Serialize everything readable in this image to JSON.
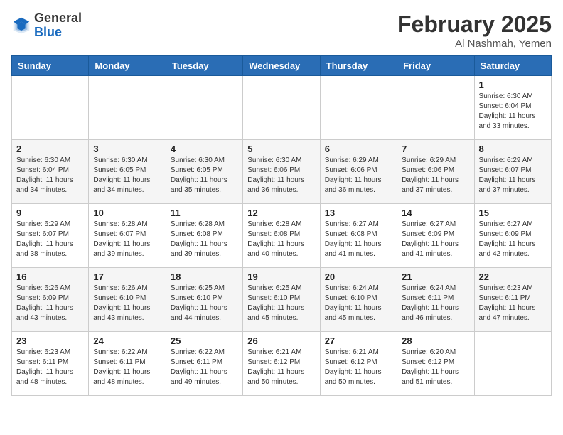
{
  "header": {
    "logo_general": "General",
    "logo_blue": "Blue",
    "month_title": "February 2025",
    "location": "Al Nashmah, Yemen"
  },
  "days_of_week": [
    "Sunday",
    "Monday",
    "Tuesday",
    "Wednesday",
    "Thursday",
    "Friday",
    "Saturday"
  ],
  "weeks": [
    [
      {
        "day": "",
        "info": ""
      },
      {
        "day": "",
        "info": ""
      },
      {
        "day": "",
        "info": ""
      },
      {
        "day": "",
        "info": ""
      },
      {
        "day": "",
        "info": ""
      },
      {
        "day": "",
        "info": ""
      },
      {
        "day": "1",
        "info": "Sunrise: 6:30 AM\nSunset: 6:04 PM\nDaylight: 11 hours\nand 33 minutes."
      }
    ],
    [
      {
        "day": "2",
        "info": "Sunrise: 6:30 AM\nSunset: 6:04 PM\nDaylight: 11 hours\nand 34 minutes."
      },
      {
        "day": "3",
        "info": "Sunrise: 6:30 AM\nSunset: 6:05 PM\nDaylight: 11 hours\nand 34 minutes."
      },
      {
        "day": "4",
        "info": "Sunrise: 6:30 AM\nSunset: 6:05 PM\nDaylight: 11 hours\nand 35 minutes."
      },
      {
        "day": "5",
        "info": "Sunrise: 6:30 AM\nSunset: 6:06 PM\nDaylight: 11 hours\nand 36 minutes."
      },
      {
        "day": "6",
        "info": "Sunrise: 6:29 AM\nSunset: 6:06 PM\nDaylight: 11 hours\nand 36 minutes."
      },
      {
        "day": "7",
        "info": "Sunrise: 6:29 AM\nSunset: 6:06 PM\nDaylight: 11 hours\nand 37 minutes."
      },
      {
        "day": "8",
        "info": "Sunrise: 6:29 AM\nSunset: 6:07 PM\nDaylight: 11 hours\nand 37 minutes."
      }
    ],
    [
      {
        "day": "9",
        "info": "Sunrise: 6:29 AM\nSunset: 6:07 PM\nDaylight: 11 hours\nand 38 minutes."
      },
      {
        "day": "10",
        "info": "Sunrise: 6:28 AM\nSunset: 6:07 PM\nDaylight: 11 hours\nand 39 minutes."
      },
      {
        "day": "11",
        "info": "Sunrise: 6:28 AM\nSunset: 6:08 PM\nDaylight: 11 hours\nand 39 minutes."
      },
      {
        "day": "12",
        "info": "Sunrise: 6:28 AM\nSunset: 6:08 PM\nDaylight: 11 hours\nand 40 minutes."
      },
      {
        "day": "13",
        "info": "Sunrise: 6:27 AM\nSunset: 6:08 PM\nDaylight: 11 hours\nand 41 minutes."
      },
      {
        "day": "14",
        "info": "Sunrise: 6:27 AM\nSunset: 6:09 PM\nDaylight: 11 hours\nand 41 minutes."
      },
      {
        "day": "15",
        "info": "Sunrise: 6:27 AM\nSunset: 6:09 PM\nDaylight: 11 hours\nand 42 minutes."
      }
    ],
    [
      {
        "day": "16",
        "info": "Sunrise: 6:26 AM\nSunset: 6:09 PM\nDaylight: 11 hours\nand 43 minutes."
      },
      {
        "day": "17",
        "info": "Sunrise: 6:26 AM\nSunset: 6:10 PM\nDaylight: 11 hours\nand 43 minutes."
      },
      {
        "day": "18",
        "info": "Sunrise: 6:25 AM\nSunset: 6:10 PM\nDaylight: 11 hours\nand 44 minutes."
      },
      {
        "day": "19",
        "info": "Sunrise: 6:25 AM\nSunset: 6:10 PM\nDaylight: 11 hours\nand 45 minutes."
      },
      {
        "day": "20",
        "info": "Sunrise: 6:24 AM\nSunset: 6:10 PM\nDaylight: 11 hours\nand 45 minutes."
      },
      {
        "day": "21",
        "info": "Sunrise: 6:24 AM\nSunset: 6:11 PM\nDaylight: 11 hours\nand 46 minutes."
      },
      {
        "day": "22",
        "info": "Sunrise: 6:23 AM\nSunset: 6:11 PM\nDaylight: 11 hours\nand 47 minutes."
      }
    ],
    [
      {
        "day": "23",
        "info": "Sunrise: 6:23 AM\nSunset: 6:11 PM\nDaylight: 11 hours\nand 48 minutes."
      },
      {
        "day": "24",
        "info": "Sunrise: 6:22 AM\nSunset: 6:11 PM\nDaylight: 11 hours\nand 48 minutes."
      },
      {
        "day": "25",
        "info": "Sunrise: 6:22 AM\nSunset: 6:11 PM\nDaylight: 11 hours\nand 49 minutes."
      },
      {
        "day": "26",
        "info": "Sunrise: 6:21 AM\nSunset: 6:12 PM\nDaylight: 11 hours\nand 50 minutes."
      },
      {
        "day": "27",
        "info": "Sunrise: 6:21 AM\nSunset: 6:12 PM\nDaylight: 11 hours\nand 50 minutes."
      },
      {
        "day": "28",
        "info": "Sunrise: 6:20 AM\nSunset: 6:12 PM\nDaylight: 11 hours\nand 51 minutes."
      },
      {
        "day": "",
        "info": ""
      }
    ]
  ]
}
